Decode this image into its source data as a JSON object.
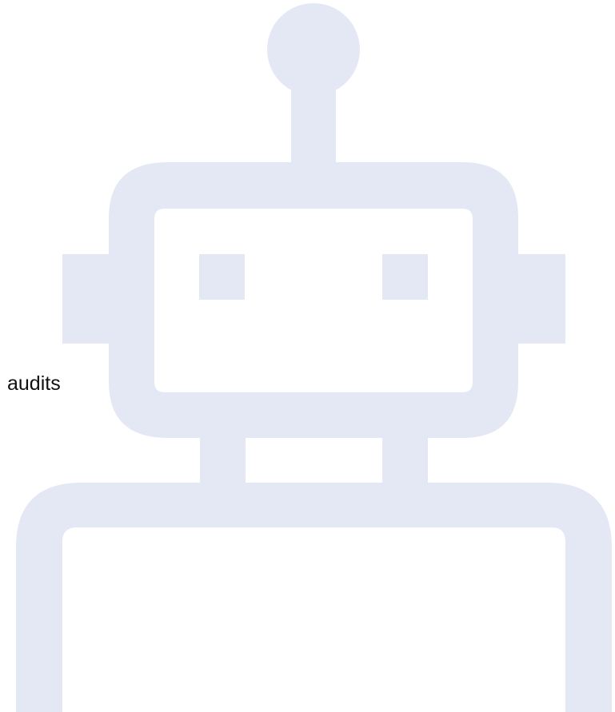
{
  "caption": {
    "text": "audits"
  },
  "illustration": {
    "icon": "robot-icon",
    "color": "#e3e8f4",
    "background": "#ffffff",
    "text_color": "#111111"
  }
}
